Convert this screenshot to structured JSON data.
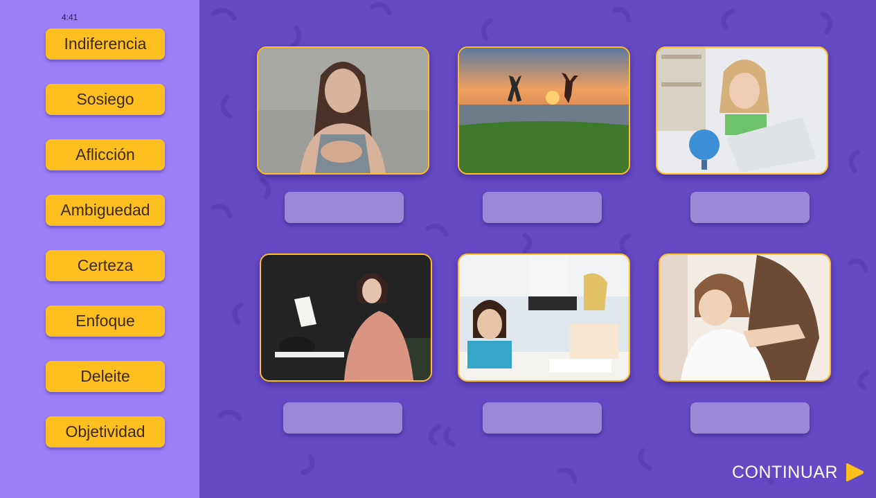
{
  "timer": {
    "text": "4:41"
  },
  "word_bank": [
    {
      "label": "Indiferencia"
    },
    {
      "label": "Sosiego"
    },
    {
      "label": "Aflicción"
    },
    {
      "label": "Ambiguedad"
    },
    {
      "label": "Certeza"
    },
    {
      "label": "Enfoque"
    },
    {
      "label": "Deleite"
    },
    {
      "label": "Objetividad"
    }
  ],
  "cards": [
    {
      "image": "woman-looking-down-photo"
    },
    {
      "image": "people-jumping-sunset-photo"
    },
    {
      "image": "girl-frustrated-laptop-photo"
    },
    {
      "image": "woman-crying-letter-photo"
    },
    {
      "image": "girl-attentive-classroom-photo"
    },
    {
      "image": "girl-hugging-mother-photo"
    }
  ],
  "continue": {
    "label": "CONTINUAR",
    "icon": "play-icon"
  },
  "colors": {
    "sidebar": "#9b7ff7",
    "main_background": "#6549c4",
    "button": "#ffbf1f",
    "drop_slot": "#9a8ad6"
  }
}
